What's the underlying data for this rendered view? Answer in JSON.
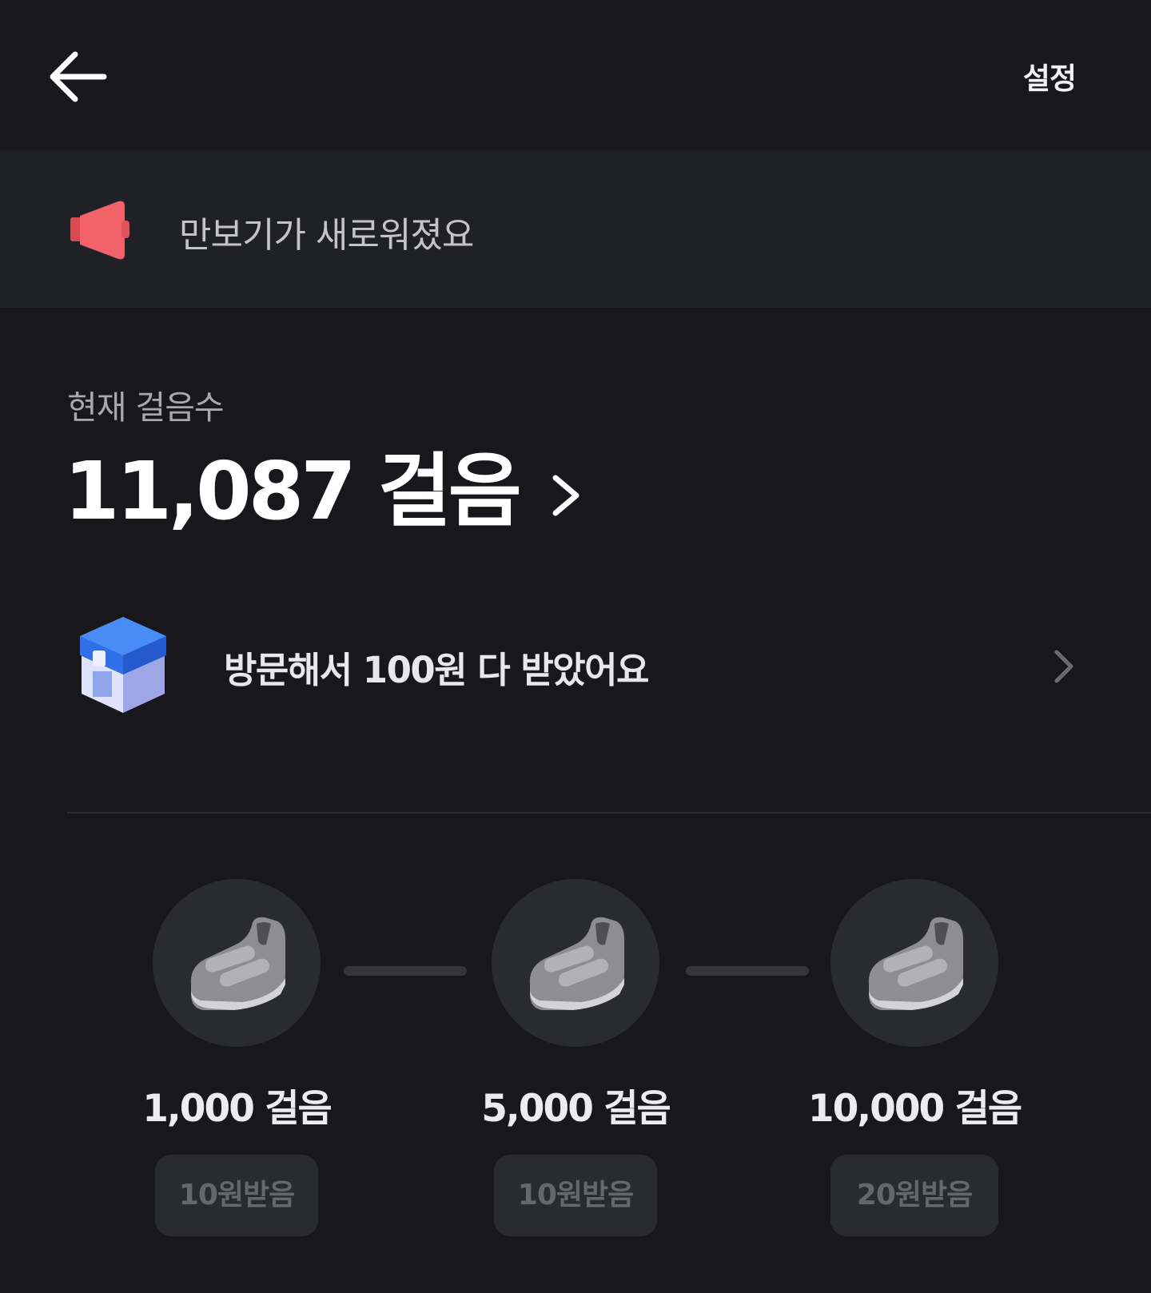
{
  "header": {
    "back_icon": "arrow-left-icon",
    "settings_label": "설정"
  },
  "notice": {
    "icon": "megaphone-icon",
    "text": "만보기가 새로워졌요"
  },
  "steps": {
    "label": "현재 걸음수",
    "count": "11,087 걸음"
  },
  "visit": {
    "icon": "store-box-icon",
    "text": "방문해서 100원 다 받았어요"
  },
  "milestones": [
    {
      "icon": "sneaker-icon",
      "label": "1,000 걸음",
      "button": "10원받음"
    },
    {
      "icon": "sneaker-icon",
      "label": "5,000 걸음",
      "button": "10원받음"
    },
    {
      "icon": "sneaker-icon",
      "label": "10,000 걸음",
      "button": "20원받음"
    }
  ],
  "colors": {
    "background": "#17171c",
    "notice_background": "#202027",
    "megaphone": "#f05a5f",
    "store_blue": "#2f6fe8",
    "circle": "#2a2a31",
    "button_text_disabled": "#66666e"
  }
}
